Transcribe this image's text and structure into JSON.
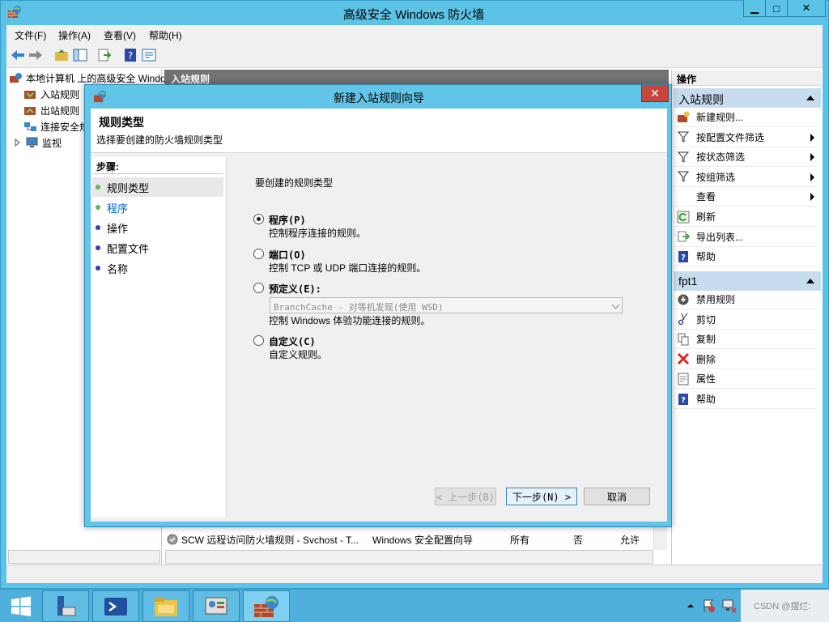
{
  "window": {
    "title": "高级安全 Windows 防火墙",
    "min_glyph": "▁",
    "max_glyph": "□",
    "close_glyph": "✕"
  },
  "menu": [
    "文件(F)",
    "操作(A)",
    "查看(V)",
    "帮助(H)"
  ],
  "tree": {
    "root": "本地计算机 上的高级安全 Windows",
    "items": [
      "入站规则",
      "出站规则",
      "连接安全规则",
      "监视"
    ]
  },
  "center": {
    "header": "入站规则",
    "row": {
      "name": "SCW 远程访问防火墙规则 - Svchost - T...",
      "group": "Windows 安全配置向导",
      "profile": "所有",
      "enabled": "否",
      "action": "允许"
    }
  },
  "actions": {
    "title": "操作",
    "section1": "入站规则",
    "items1": [
      {
        "label": "新建规则...",
        "icon": "new-rule-icon"
      },
      {
        "label": "按配置文件筛选",
        "icon": "filter-icon",
        "sub": true
      },
      {
        "label": "按状态筛选",
        "icon": "filter-icon",
        "sub": true
      },
      {
        "label": "按组筛选",
        "icon": "filter-icon",
        "sub": true
      },
      {
        "label": "查看",
        "icon": "",
        "sub": true
      },
      {
        "label": "刷新",
        "icon": "refresh-icon"
      },
      {
        "label": "导出列表...",
        "icon": "export-icon"
      },
      {
        "label": "帮助",
        "icon": "help-icon"
      }
    ],
    "section2": "fpt1",
    "items2": [
      {
        "label": "禁用规则",
        "icon": "disable-icon"
      },
      {
        "label": "剪切",
        "icon": "cut-icon"
      },
      {
        "label": "复制",
        "icon": "copy-icon"
      },
      {
        "label": "删除",
        "icon": "delete-icon"
      },
      {
        "label": "属性",
        "icon": "properties-icon"
      },
      {
        "label": "帮助",
        "icon": "help-icon"
      }
    ]
  },
  "wizard": {
    "title": "新建入站规则向导",
    "heading": "规则类型",
    "subheading": "选择要创建的防火墙规则类型",
    "close_glyph": "✕",
    "steps_title": "步骤:",
    "steps": [
      {
        "label": "规则类型",
        "color": "#5cb85c"
      },
      {
        "label": "程序",
        "color": "#5cb85c"
      },
      {
        "label": "操作",
        "color": "#3a3aa8"
      },
      {
        "label": "配置文件",
        "color": "#3a3aa8"
      },
      {
        "label": "名称",
        "color": "#3a3aa8"
      }
    ],
    "prompt": "要创建的规则类型",
    "options": [
      {
        "label": "程序(P)",
        "desc": "控制程序连接的规则。",
        "selected": true
      },
      {
        "label": "端口(O)",
        "desc": "控制 TCP 或 UDP 端口连接的规则。",
        "selected": false
      },
      {
        "label": "预定义(E):",
        "desc": "控制 Windows 体验功能连接的规则。",
        "selected": false
      },
      {
        "label": "自定义(C)",
        "desc": "自定义规则。",
        "selected": false
      }
    ],
    "predefined_value": "BranchCache - 对等机发现(使用 WSD)",
    "back_label": "< 上一步(B)",
    "next_label": "下一步(N) >",
    "cancel_label": "取消"
  },
  "tray": {
    "watermark": "CSDN @摆烂:"
  },
  "colors": {
    "accent": "#5cc3e6",
    "close_red": "#c7463c",
    "section_blue": "#c8dcf0"
  }
}
